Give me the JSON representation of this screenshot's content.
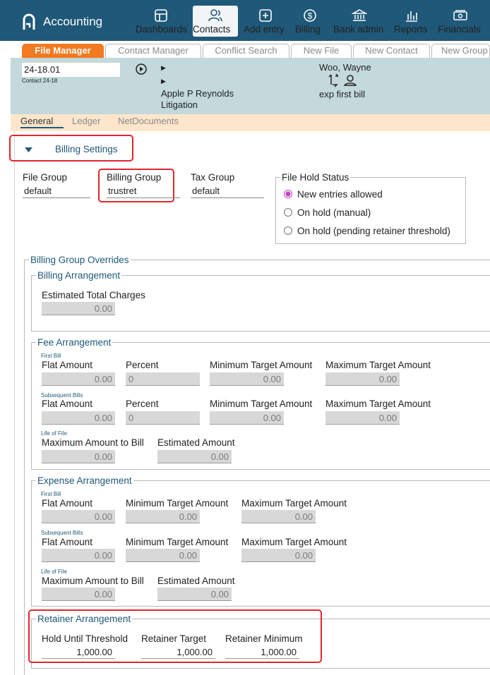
{
  "nav": {
    "app_title": "Accounting",
    "items": [
      {
        "label": "Dashboards",
        "icon": "dashboard-icon"
      },
      {
        "label": "Contacts",
        "icon": "contacts-icon"
      },
      {
        "label": "Add entry",
        "icon": "plus-square-icon"
      },
      {
        "label": "Billing",
        "icon": "dollar-circle-icon"
      },
      {
        "label": "Bank admin",
        "icon": "bank-icon"
      },
      {
        "label": "Reports",
        "icon": "bar-chart-icon"
      },
      {
        "label": "Financials",
        "icon": "money-icon"
      }
    ]
  },
  "tabs": [
    "File Manager",
    "Contact Manager",
    "Conflict Search",
    "New File",
    "New Contact",
    "New Group"
  ],
  "header": {
    "file_number": "24-18.01",
    "contact_id": "Contact 24-18",
    "client_name": "Apple P Reynolds",
    "matter_type": "Litigation",
    "responsible": "Woo, Wayne",
    "note": "exp first bill"
  },
  "subtabs": [
    "General",
    "Ledger",
    "NetDocuments"
  ],
  "billing": {
    "section_title": "Billing Settings",
    "file_group_label": "File Group",
    "file_group_value": "default",
    "billing_group_label": "Billing Group",
    "billing_group_value": "trustret",
    "tax_group_label": "Tax Group",
    "tax_group_value": "default",
    "hold": {
      "legend": "File Hold Status",
      "options": [
        "New entries allowed",
        "On hold (manual)",
        "On hold (pending retainer threshold)"
      ],
      "selected": "New entries allowed"
    },
    "overrides_legend": "Billing Group Overrides",
    "billing_arrangement": {
      "legend": "Billing Arrangement",
      "est_label": "Estimated Total Charges",
      "est_value": "0.00"
    },
    "fee": {
      "legend": "Fee Arrangement",
      "first_bill": "First Bill",
      "subsequent": "Subsequent Bills",
      "life": "Life of File",
      "flat_label": "Flat Amount",
      "percent_label": "Percent",
      "min_label": "Minimum Target Amount",
      "max_label": "Maximum Target Amount",
      "max_bill_label": "Maximum Amount to Bill",
      "est_label": "Estimated Amount",
      "flat1": "0.00",
      "pct1": "0",
      "min1": "0.00",
      "max1": "0.00",
      "flat2": "0.00",
      "pct2": "0",
      "min2": "0.00",
      "max2": "0.00",
      "maxbill": "0.00",
      "est": "0.00"
    },
    "expense": {
      "legend": "Expense Arrangement",
      "first_bill": "First Bill",
      "subsequent": "Subsequent Bills",
      "life": "Life of File",
      "flat_label": "Flat Amount",
      "min_label": "Minimum Target Amount",
      "max_label": "Maximum Target Amount",
      "max_bill_label": "Maximum Amount to Bill",
      "est_label": "Estimated Amount",
      "flat1": "0.00",
      "min1": "0.00",
      "max1": "0.00",
      "flat2": "0.00",
      "min2": "0.00",
      "max2": "0.00",
      "maxbill": "0.00",
      "est": "0.00"
    },
    "retainer": {
      "legend": "Retainer Arrangement",
      "hold_label": "Hold Until Threshold",
      "target_label": "Retainer Target",
      "min_label": "Retainer Minimum",
      "hold_value": "1,000.00",
      "target_value": "1,000.00",
      "min_value": "1,000.00"
    }
  },
  "colors": {
    "nav_bg": "#1f5878",
    "tab_active": "#f47a21",
    "info_bg": "#c3d9dc",
    "subtab_bg": "#fde6cc",
    "highlight": "#e1262d"
  }
}
